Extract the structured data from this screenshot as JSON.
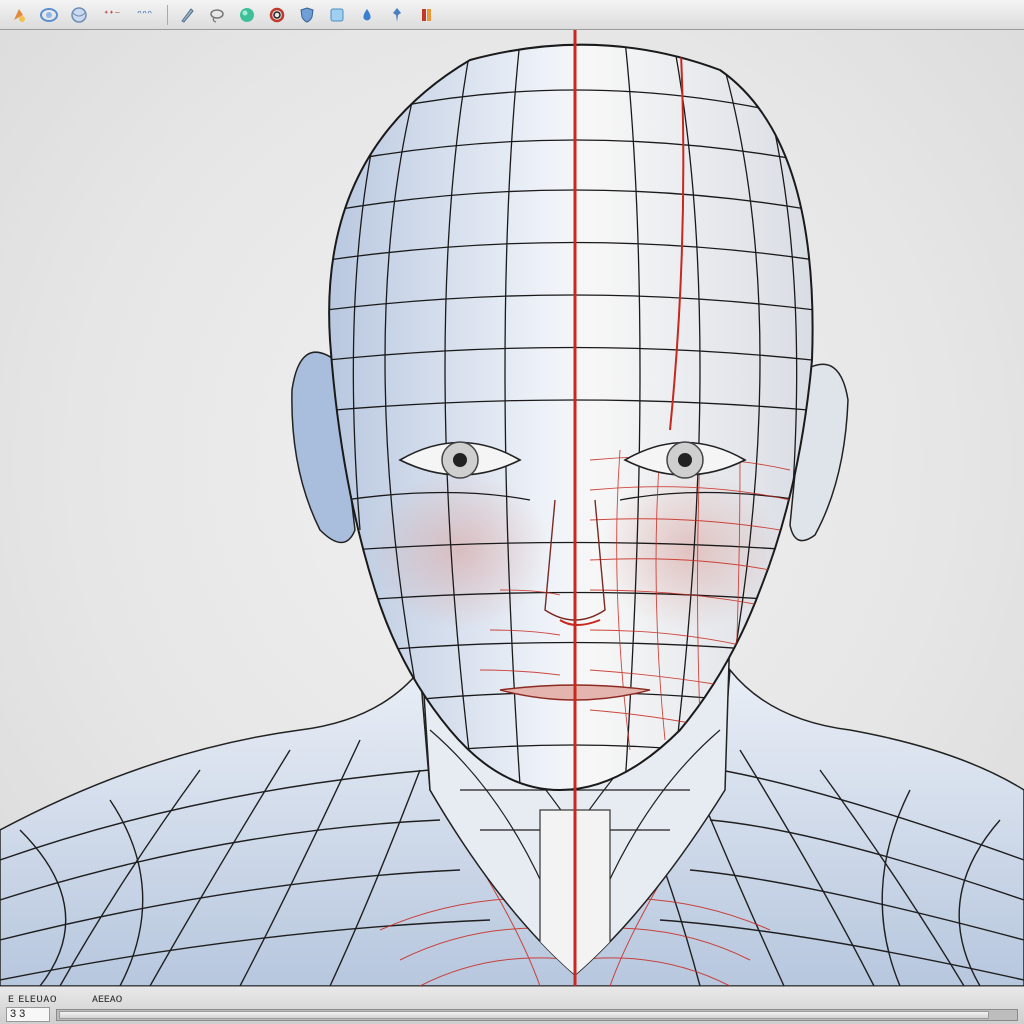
{
  "toolbar": {
    "label_a": "ᐩᐩ⁻",
    "label_b": "ᵔᵔᵔ",
    "icons": [
      "paint-icon",
      "orbit-icon",
      "sphere-icon",
      "pen-icon",
      "lasso-icon",
      "material-icon",
      "ring-icon",
      "shield-icon",
      "cube-icon",
      "drop-icon",
      "pin-icon",
      "flag-icon"
    ],
    "colors": {
      "accent_red": "#c03a2b",
      "accent_blue": "#3a7fd0",
      "accent_teal": "#38b89a"
    }
  },
  "viewport": {
    "subject": "wireframe-head-mesh",
    "mesh_line_color": "#1f1f1f",
    "symmetry_line_color": "#c8281e"
  },
  "statusbar": {
    "text_left": "ᴇ ᴇʟᴇᴜᴀᴏ",
    "text_right": "ᴀᴇᴇᴀᴏ",
    "field_value": "3 3"
  }
}
